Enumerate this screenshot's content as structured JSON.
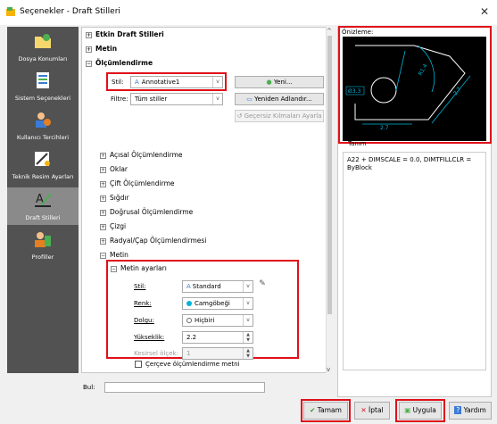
{
  "window": {
    "title": "Seçenekler - Draft Stilleri",
    "close": "✕"
  },
  "sidebar": {
    "items": [
      {
        "label": "Dosya Konumları",
        "icon": "folder-icon"
      },
      {
        "label": "Sistem Seçenekleri",
        "icon": "system-icon"
      },
      {
        "label": "Kullanıcı Tercihleri",
        "icon": "user-icon"
      },
      {
        "label": "Teknik Resim Ayarları",
        "icon": "drawing-settings-icon"
      },
      {
        "label": "Draft Stilleri",
        "icon": "draft-styles-icon",
        "active": true
      },
      {
        "label": "Profiller",
        "icon": "profiles-icon"
      }
    ]
  },
  "tree": {
    "top": [
      {
        "label": "Etkin Draft Stilleri",
        "expander": "+",
        "bold": true
      },
      {
        "label": "Metin",
        "expander": "+",
        "bold": true
      },
      {
        "label": "Ölçümlendirme",
        "expander": "−",
        "bold": true
      }
    ],
    "style_label": "Stil:",
    "style_value": "Annotative1",
    "filter_label": "Filtre:",
    "filter_value": "Tüm stiller",
    "btn_new": "Yeni...",
    "btn_rename": "Yeniden Adlandır...",
    "btn_reset": "Geçersiz Kılmaları Ayarla",
    "sections": [
      {
        "label": "Açısal Ölçümlendirme",
        "expander": "+"
      },
      {
        "label": "Oklar",
        "expander": "+"
      },
      {
        "label": "Çift Ölçümlendirme",
        "expander": "+"
      },
      {
        "label": "Sığdır",
        "expander": "+"
      },
      {
        "label": "Doğrusal Ölçümlendirme",
        "expander": "+"
      },
      {
        "label": "Çizgi",
        "expander": "+"
      },
      {
        "label": "Radyal/Çap Ölçümlendirmesi",
        "expander": "+"
      },
      {
        "label": "Metin",
        "expander": "−"
      }
    ],
    "text_settings": {
      "header": "Metin ayarları",
      "style_label": "Stil:",
      "style_value": "Standard",
      "color_label": "Renk:",
      "color_value": "Camgöbeği",
      "color_hex": "#00b4d8",
      "fill_label": "Dolgu:",
      "fill_value": "Hiçbiri",
      "height_label": "Yükseklik:",
      "height_value": "2.2",
      "scale_label": "Kesirsel ölçek:",
      "scale_value": "1",
      "frame_label": "Çerçeve ölçümlendirme metni"
    }
  },
  "preview": {
    "label": "Önizleme:",
    "desc_label": "Tanım",
    "desc_text": "A22 + DIMSCALE = 0.0, DIMTFILLCLR = ByBlock",
    "dims": {
      "d1": "Ø3.3",
      "d2": "2.7",
      "d3": "R1.4",
      "d4": "2.7"
    }
  },
  "search": {
    "label": "Bul:",
    "value": ""
  },
  "buttons": {
    "ok": "Tamam",
    "cancel": "İptal",
    "apply": "Uygula",
    "help": "Yardım"
  },
  "colors": {
    "accent": "#e0101a",
    "cyan": "#00b4d8",
    "highlight": "#cce4f7"
  }
}
